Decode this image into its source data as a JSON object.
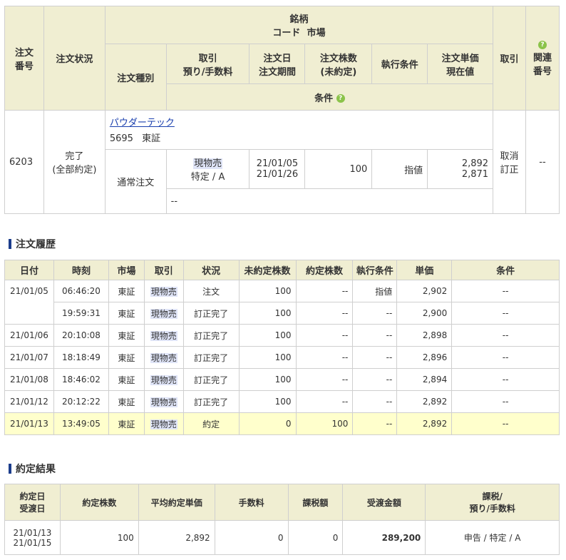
{
  "order": {
    "headers": {
      "order_no": "注文\n番号",
      "status": "注文状況",
      "meigara": "銘柄",
      "code_market": "コード  市場",
      "order_type": "注文種別",
      "torihiki": "取引\n預り/手数料",
      "order_date": "注文日\n注文期間",
      "shares": "注文株数\n(未約定)",
      "exec_cond": "執行条件",
      "unit_price": "注文単価\n現在値",
      "torihiki2": "取引",
      "related": "関連\n番号",
      "conditions": "条件"
    },
    "row": {
      "order_no": "6203",
      "status": "完了\n(全部約定)",
      "stock_name": "パウダーテック",
      "code": "5695",
      "market": "東証",
      "order_type": "通常注文",
      "torihiki": "現物売",
      "account": "特定 / A",
      "order_date": "21/01/05",
      "period": "21/01/26",
      "shares": "100",
      "exec_cond": "指値",
      "unit_price": "2,892",
      "current_price": "2,871",
      "cancel": "取消",
      "correct": "訂正",
      "related": "--",
      "conditions": "--"
    }
  },
  "history": {
    "title": "注文履歴",
    "columns": [
      "日付",
      "時刻",
      "市場",
      "取引",
      "状況",
      "未約定株数",
      "約定株数",
      "執行条件",
      "単価",
      "条件"
    ],
    "rows": [
      {
        "date": "21/01/05",
        "time": "06:46:20",
        "market": "東証",
        "torihiki": "現物売",
        "status": "注文",
        "unfilled": "100",
        "filled": "--",
        "exec": "指値",
        "price": "2,902",
        "cond": "--"
      },
      {
        "date": "",
        "time": "19:59:31",
        "market": "東証",
        "torihiki": "現物売",
        "status": "訂正完了",
        "unfilled": "100",
        "filled": "--",
        "exec": "--",
        "price": "2,900",
        "cond": "--"
      },
      {
        "date": "21/01/06",
        "time": "20:10:08",
        "market": "東証",
        "torihiki": "現物売",
        "status": "訂正完了",
        "unfilled": "100",
        "filled": "--",
        "exec": "--",
        "price": "2,898",
        "cond": "--"
      },
      {
        "date": "21/01/07",
        "time": "18:18:49",
        "market": "東証",
        "torihiki": "現物売",
        "status": "訂正完了",
        "unfilled": "100",
        "filled": "--",
        "exec": "--",
        "price": "2,896",
        "cond": "--"
      },
      {
        "date": "21/01/08",
        "time": "18:46:02",
        "market": "東証",
        "torihiki": "現物売",
        "status": "訂正完了",
        "unfilled": "100",
        "filled": "--",
        "exec": "--",
        "price": "2,894",
        "cond": "--"
      },
      {
        "date": "21/01/12",
        "time": "20:12:22",
        "market": "東証",
        "torihiki": "現物売",
        "status": "訂正完了",
        "unfilled": "100",
        "filled": "--",
        "exec": "--",
        "price": "2,892",
        "cond": "--"
      },
      {
        "date": "21/01/13",
        "time": "13:49:05",
        "market": "東証",
        "torihiki": "現物売",
        "status": "約定",
        "unfilled": "0",
        "filled": "100",
        "exec": "--",
        "price": "2,892",
        "cond": "--"
      }
    ]
  },
  "result": {
    "title": "約定結果",
    "columns": {
      "date": "約定日\n受渡日",
      "shares": "約定株数",
      "avg_price": "平均約定単価",
      "fee": "手数料",
      "tax": "課税額",
      "amount": "受渡金額",
      "account": "課税/\n預り/手数料"
    },
    "row": {
      "exec_date": "21/01/13",
      "delivery_date": "21/01/15",
      "shares": "100",
      "avg_price": "2,892",
      "fee": "0",
      "tax": "0",
      "amount": "289,200",
      "account": "申告 / 特定 / A"
    }
  },
  "colors": {
    "header_bg": "#f0eed2",
    "highlight_row": "#ffffcc",
    "link": "#1a3fae",
    "help_icon": "#8bc34a"
  }
}
